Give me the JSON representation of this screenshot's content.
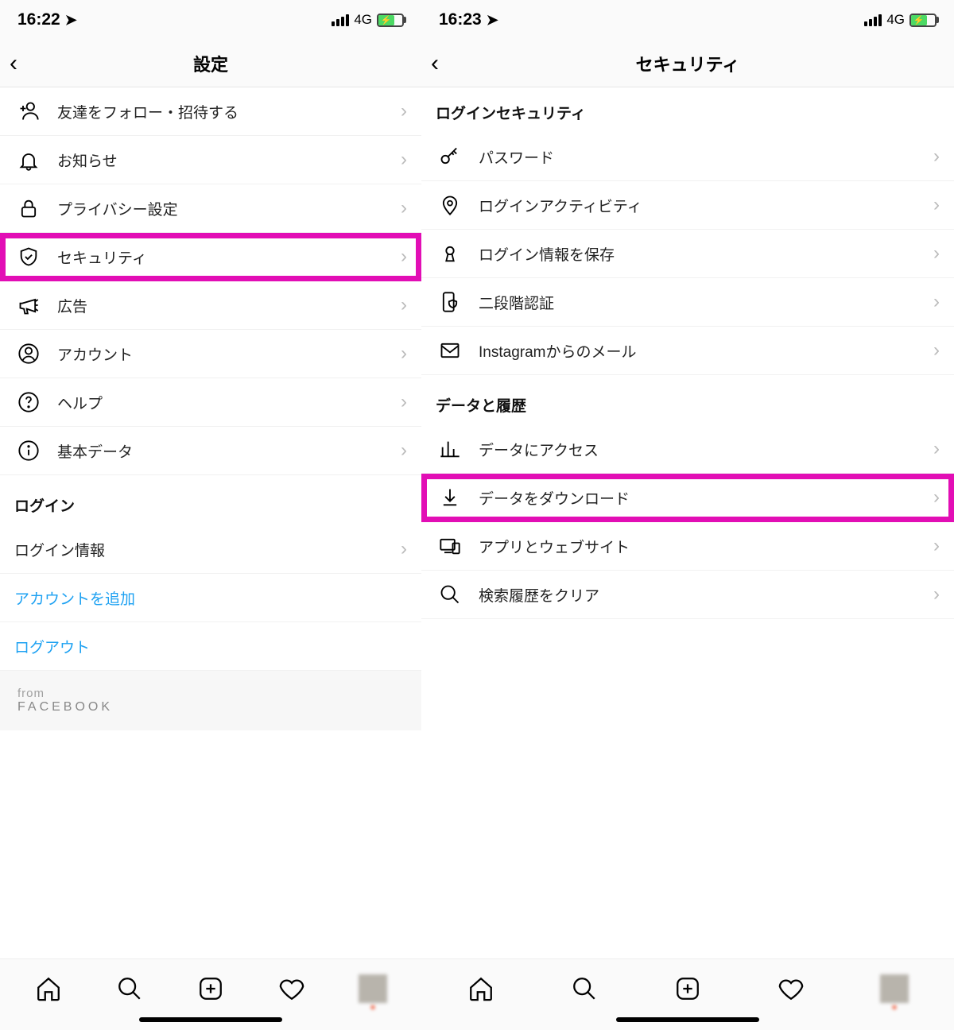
{
  "left": {
    "status": {
      "time": "16:22",
      "network": "4G"
    },
    "nav_title": "設定",
    "items": [
      {
        "icon": "add-person-icon",
        "label": "友達をフォロー・招待する"
      },
      {
        "icon": "bell-icon",
        "label": "お知らせ"
      },
      {
        "icon": "lock-icon",
        "label": "プライバシー設定"
      },
      {
        "icon": "shield-check-icon",
        "label": "セキュリティ",
        "highlight": true
      },
      {
        "icon": "megaphone-icon",
        "label": "広告"
      },
      {
        "icon": "account-icon",
        "label": "アカウント"
      },
      {
        "icon": "help-icon",
        "label": "ヘルプ"
      },
      {
        "icon": "info-icon",
        "label": "基本データ"
      }
    ],
    "login_header": "ログイン",
    "login_info": "ログイン情報",
    "add_account": "アカウントを追加",
    "logout": "ログアウト",
    "from": "from",
    "facebook": "FACEBOOK"
  },
  "right": {
    "status": {
      "time": "16:23",
      "network": "4G"
    },
    "nav_title": "セキュリティ",
    "section1_header": "ログインセキュリティ",
    "section1": [
      {
        "icon": "key-icon",
        "label": "パスワード"
      },
      {
        "icon": "location-pin-icon",
        "label": "ログインアクティビティ"
      },
      {
        "icon": "keyhole-icon",
        "label": "ログイン情報を保存"
      },
      {
        "icon": "phone-shield-icon",
        "label": "二段階認証"
      },
      {
        "icon": "mail-icon",
        "label": "Instagramからのメール"
      }
    ],
    "section2_header": "データと履歴",
    "section2": [
      {
        "icon": "bar-chart-icon",
        "label": "データにアクセス"
      },
      {
        "icon": "download-icon",
        "label": "データをダウンロード",
        "highlight": true
      },
      {
        "icon": "devices-icon",
        "label": "アプリとウェブサイト"
      },
      {
        "icon": "search-icon",
        "label": "検索履歴をクリア"
      }
    ]
  }
}
